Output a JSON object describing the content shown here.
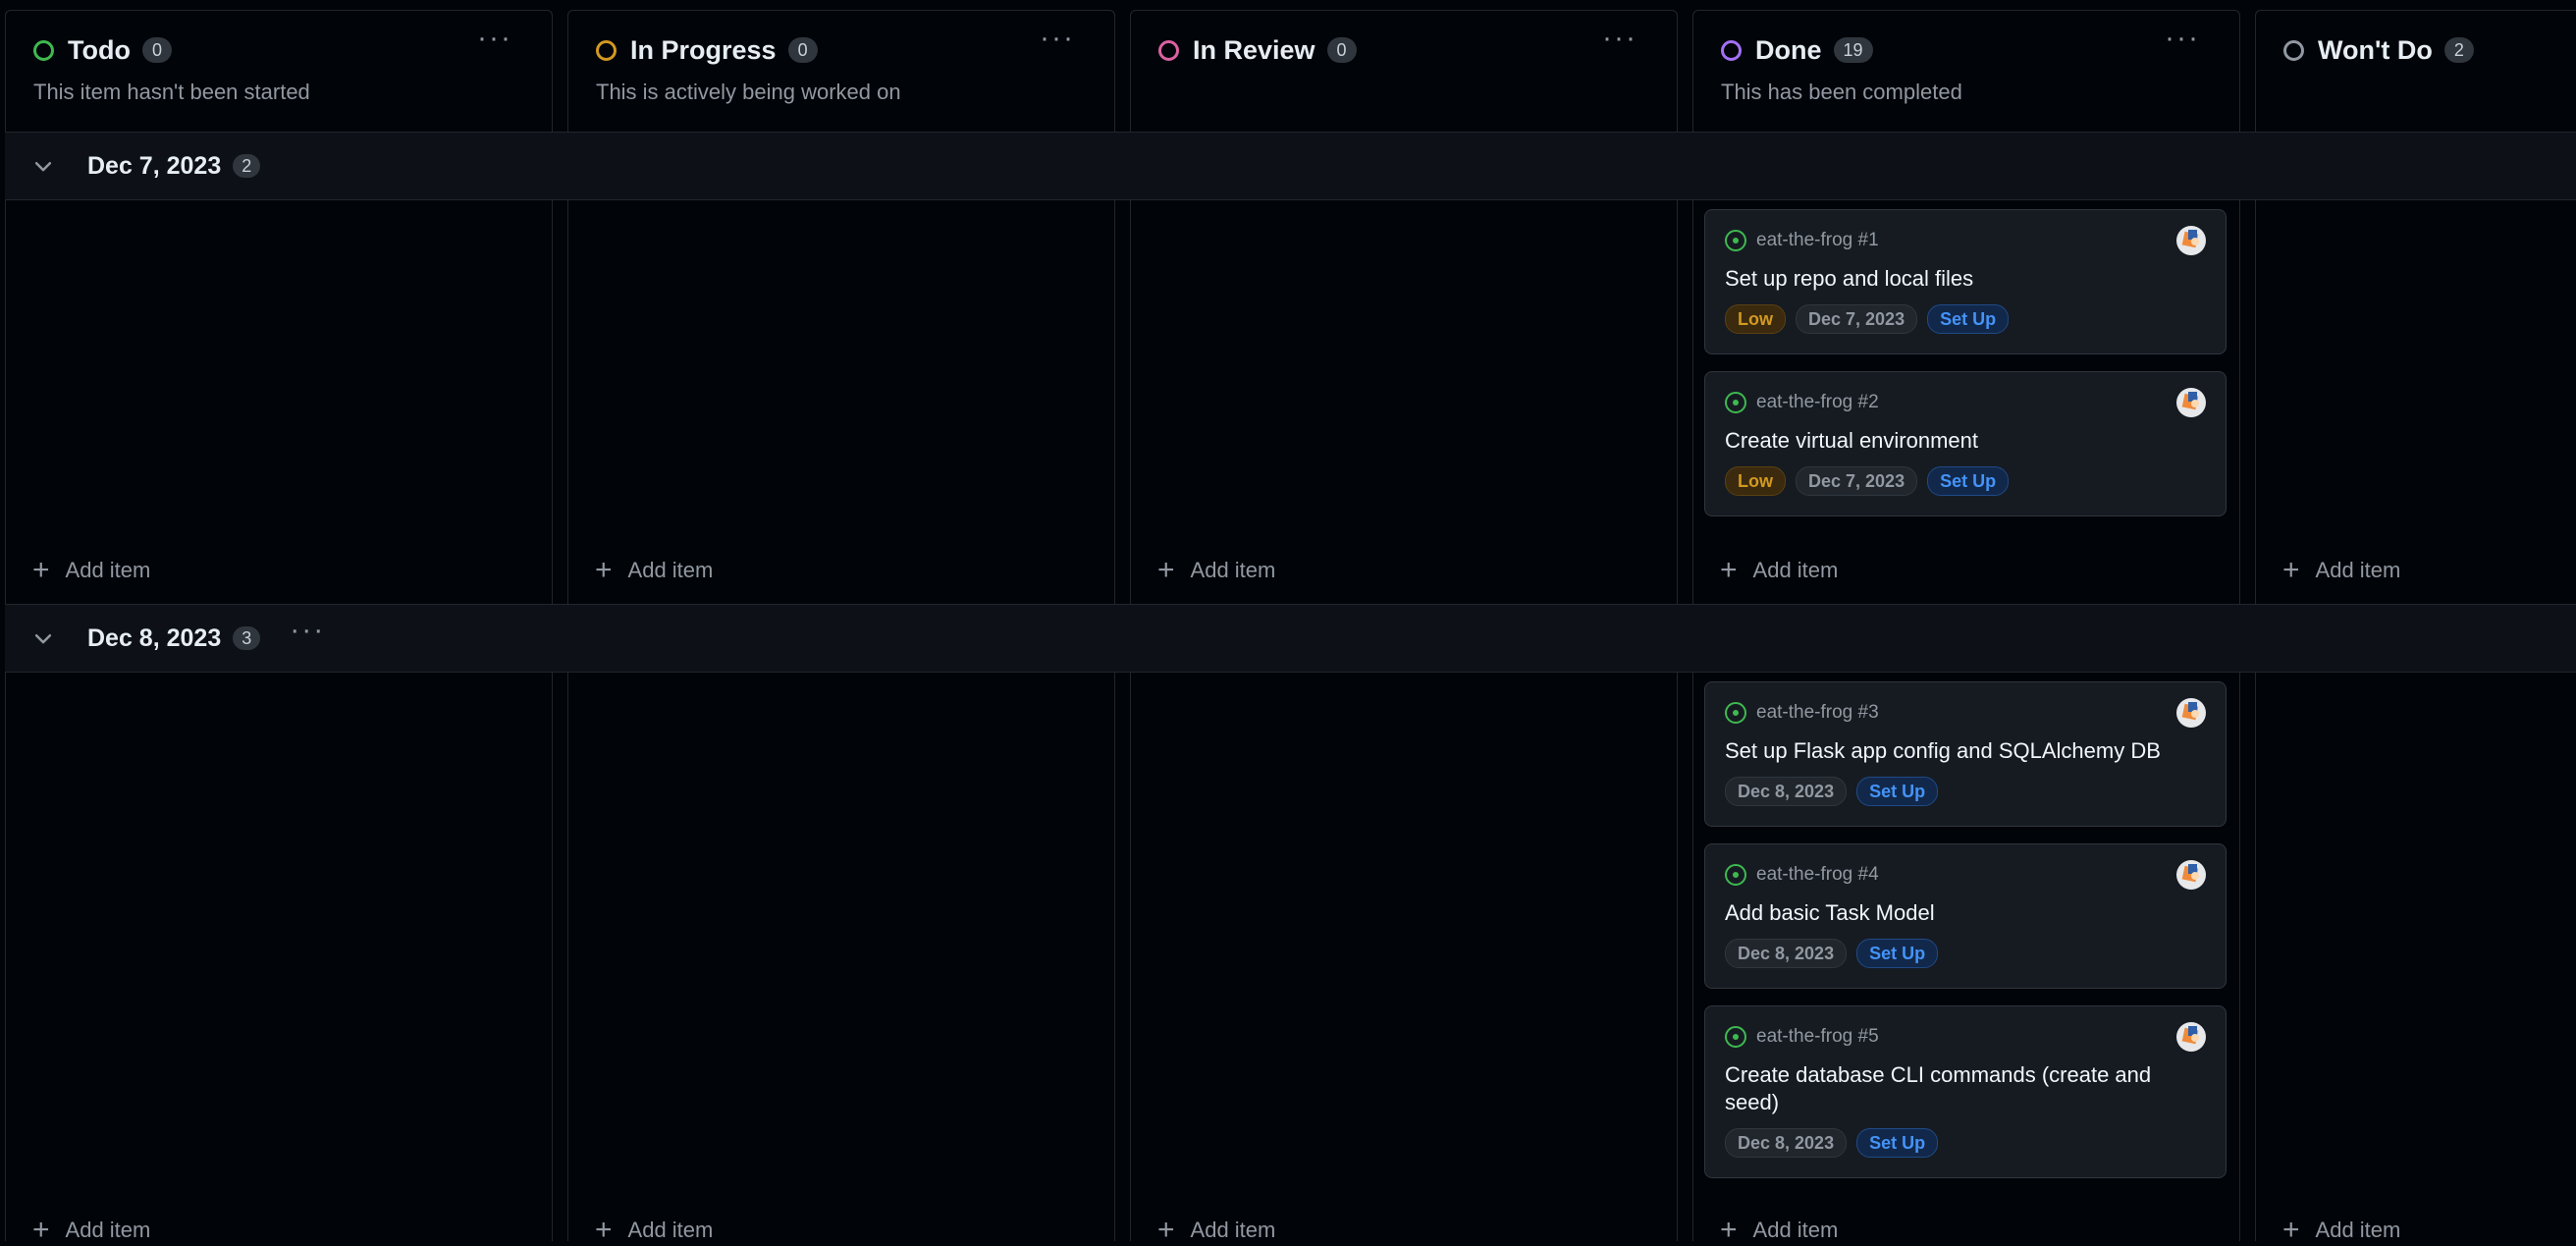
{
  "columns": [
    {
      "title": "Todo",
      "count": "0",
      "description": "This item hasn't been started",
      "color": "#3fb950"
    },
    {
      "title": "In Progress",
      "count": "0",
      "description": "This is actively being worked on",
      "color": "#d29922"
    },
    {
      "title": "In Review",
      "count": "0",
      "description": "",
      "color": "#db61a2"
    },
    {
      "title": "Done",
      "count": "19",
      "description": "This has been completed",
      "color": "#a371f7"
    },
    {
      "title": "Won't Do",
      "count": "2",
      "description": "",
      "color": "#9198a1"
    }
  ],
  "groups": [
    {
      "title": "Dec 7, 2023",
      "count": "2"
    },
    {
      "title": "Dec 8, 2023",
      "count": "3"
    }
  ],
  "add_item_label": "Add item",
  "cards": [
    {
      "ref": "eat-the-frog #1",
      "title": "Set up repo and local files",
      "labels": [
        "Low",
        "Dec 7, 2023",
        "Set Up"
      ]
    },
    {
      "ref": "eat-the-frog #2",
      "title": "Create virtual environment",
      "labels": [
        "Low",
        "Dec 7, 2023",
        "Set Up"
      ]
    },
    {
      "ref": "eat-the-frog #3",
      "title": "Set up Flask app config and SQLAlchemy DB",
      "labels": [
        "Dec 8, 2023",
        "Set Up"
      ]
    },
    {
      "ref": "eat-the-frog #4",
      "title": "Add basic Task Model",
      "labels": [
        "Dec 8, 2023",
        "Set Up"
      ]
    },
    {
      "ref": "eat-the-frog #5",
      "title": "Create database CLI commands (create and seed)",
      "labels": [
        "Dec 8, 2023",
        "Set Up"
      ]
    }
  ],
  "icons": {
    "status": "status-circle-icon",
    "menu": "ellipsis-icon",
    "collapse": "chevron-down-icon",
    "add": "plus-icon",
    "issue": "issue-open-icon"
  }
}
